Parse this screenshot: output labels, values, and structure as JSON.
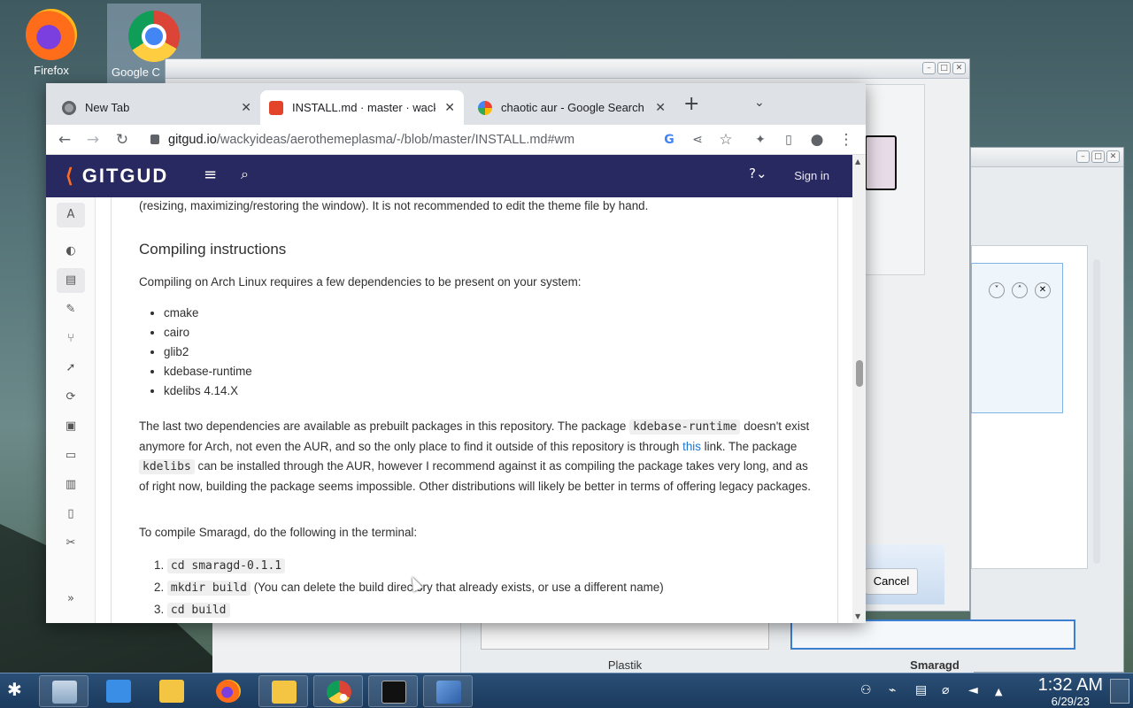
{
  "desktop": {
    "icons": [
      {
        "label": "Firefox"
      },
      {
        "label": "Google C"
      }
    ]
  },
  "background_windows": {
    "buttons": {
      "cancel": "Cancel"
    },
    "labels": {
      "plastik": "Plastik",
      "smaragd": "Smaragd"
    }
  },
  "browser": {
    "tabs": [
      {
        "title": "New Tab",
        "favicon": "chrome-icon"
      },
      {
        "title": "INSTALL.md · master · wacky",
        "favicon": "gitlab-icon"
      },
      {
        "title": "chaotic aur - Google Search",
        "favicon": "google-icon"
      }
    ],
    "url": {
      "host": "gitgud.io",
      "path": "/wackyideas/aerothemeplasma/-/blob/master/INSTALL.md#wm"
    }
  },
  "gitgud": {
    "logo": "GITGUD",
    "sign_in": "Sign in",
    "sidebar_top": "A"
  },
  "doc": {
    "intro_tail": "(resizing, maximizing/restoring the window). It is not recommended to edit the theme file by hand.",
    "heading": "Compiling instructions",
    "deps_intro": "Compiling on Arch Linux requires a few dependencies to be present on your system:",
    "deps": [
      "cmake",
      "cairo",
      "glib2",
      "kdebase-runtime",
      "kdelibs 4.14.X"
    ],
    "para": {
      "a": "The last two dependencies are available as prebuilt packages in this repository. The package",
      "code1": "kdebase-runtime",
      "b": "doesn't exist anymore for Arch, not even the AUR, and so the only place to find it outside of this repository is through",
      "link": "this",
      "c": "link. The package",
      "code2": "kdelibs",
      "d": "can be installed through the AUR, however I recommend against it as compiling the package takes very long, and as of right now, building the package seems impossible. Other distributions will likely be better in terms of offering legacy packages."
    },
    "compile_intro": "To compile Smaragd, do the following in the terminal:",
    "steps": [
      {
        "code": "cd smaragd-0.1.1",
        "note": ""
      },
      {
        "code": "mkdir build",
        "note": "(You can delete the build directory that already exists, or use a different name)"
      },
      {
        "code": "cd build",
        "note": ""
      }
    ]
  },
  "taskbar": {
    "time": "1:32 AM",
    "date": "6/29/23"
  },
  "colors": {
    "gitgud_header": "#292961",
    "gitlab_orange": "#fc6d26",
    "taskbar": "#1b3a5d",
    "link": "#1f75cb"
  }
}
